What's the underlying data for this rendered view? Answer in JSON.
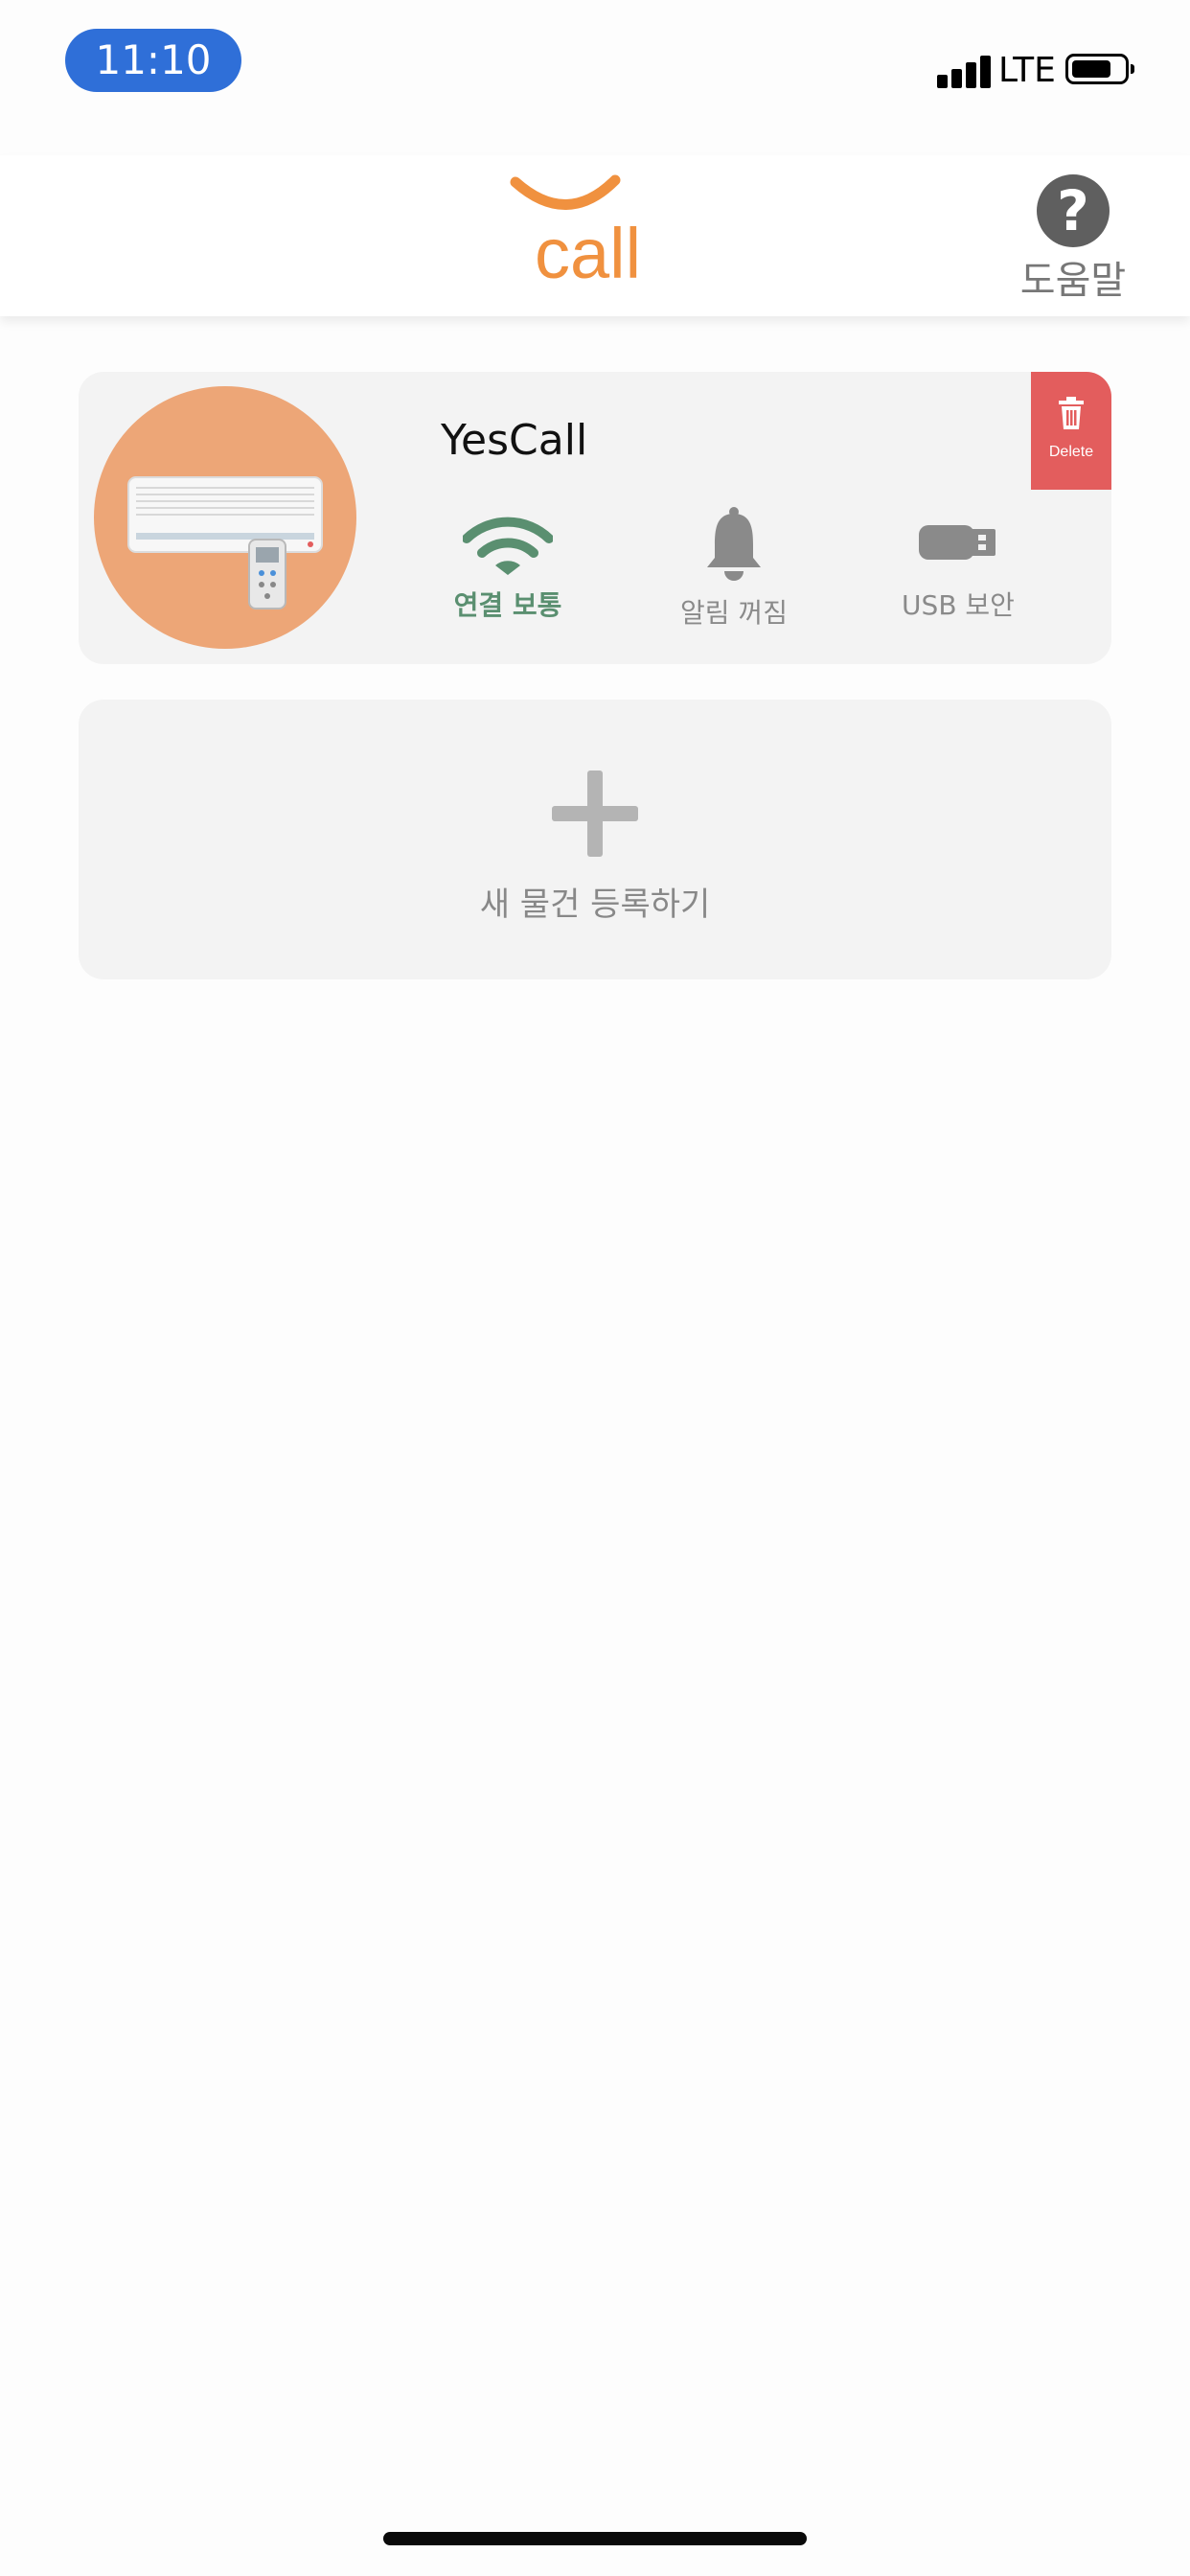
{
  "status_bar": {
    "time": "11:10",
    "network": "LTE",
    "signal_bars": 4,
    "battery_level": 0.75,
    "time_pill_color": "#2f6fd8"
  },
  "header": {
    "logo_text": "call",
    "logo_color": "#f0913f",
    "help_icon": "question-circle-icon",
    "help_label": "도움말"
  },
  "device": {
    "name": "YesCall",
    "image": "air-conditioner-with-remote",
    "image_bg_color": "#eda677",
    "delete_label": "Delete",
    "delete_color": "#e35d5d",
    "statuses": [
      {
        "icon": "wifi-icon",
        "label": "연결 보통",
        "color": "#5a8f70"
      },
      {
        "icon": "bell-icon",
        "label": "알림 꺼짐",
        "color": "#8a8a8a"
      },
      {
        "icon": "usb-icon",
        "label": "USB 보안",
        "color": "#8a8a8a"
      }
    ]
  },
  "add_card": {
    "icon": "plus-icon",
    "label": "새 물건 등록하기"
  }
}
